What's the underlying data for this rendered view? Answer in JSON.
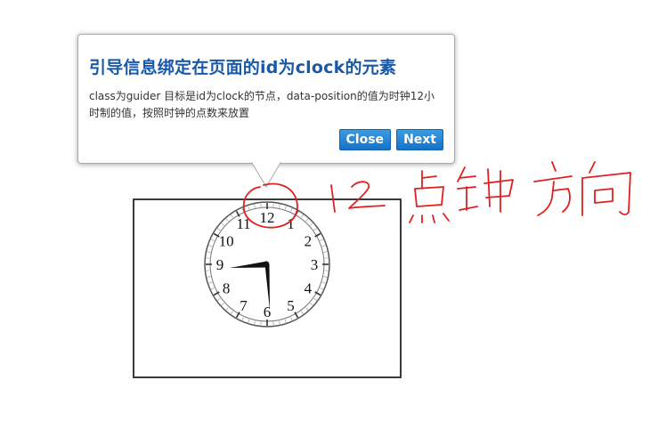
{
  "guider": {
    "title": "引导信息绑定在页面的id为clock的元素",
    "description": "class为guider 目标是id为clock的节点，data-position的值为时钟12小时制的值，按照时钟的点数来放置",
    "buttons": {
      "close_label": "Close",
      "next_label": "Next"
    },
    "accent_color": "#1a58a8",
    "button_color": "#1572c8"
  },
  "clock": {
    "numerals": [
      "12",
      "1",
      "2",
      "3",
      "4",
      "5",
      "6",
      "7",
      "8",
      "9",
      "10",
      "11"
    ],
    "time_shown": "8:29"
  },
  "annotation": {
    "handwritten_note": "12点钟方向",
    "ink_color": "#e02020"
  }
}
